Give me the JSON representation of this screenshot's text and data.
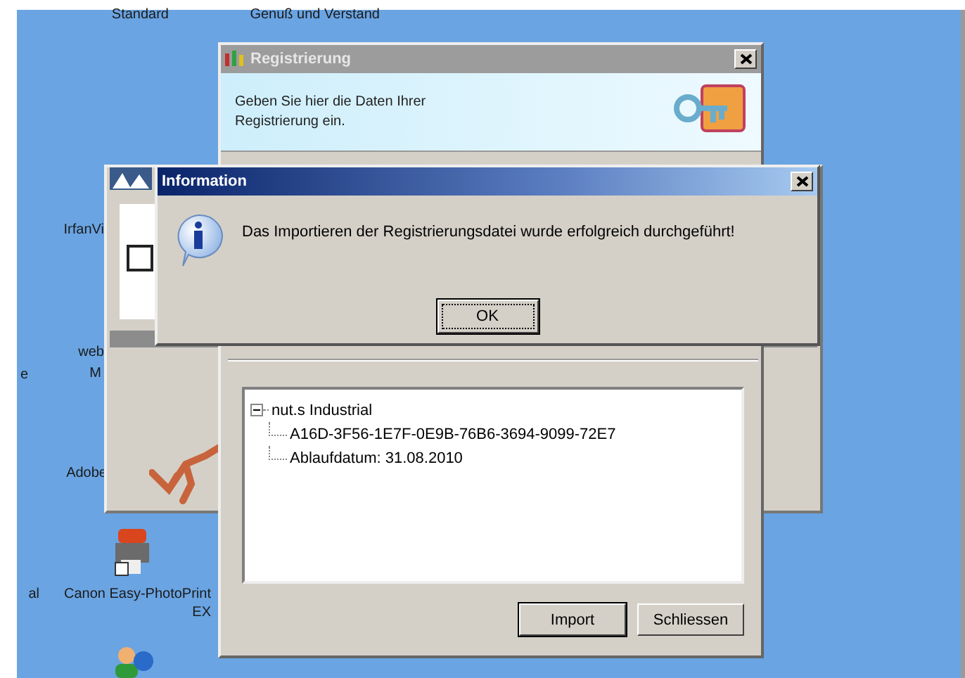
{
  "desktop_labels": [
    {
      "label": "Standard"
    },
    {
      "label": "Genuß und Verstand"
    },
    {
      "label": "IrfanVi"
    },
    {
      "label": "web"
    },
    {
      "label": "M"
    },
    {
      "label": "e"
    },
    {
      "label": "Adobe"
    },
    {
      "label": "al"
    },
    {
      "label": "Canon Easy-PhotoPrint EX"
    }
  ],
  "background_window": {
    "checkbox": {
      "checked": false
    }
  },
  "registration_window": {
    "title": "Registrierung",
    "header_text": "Geben Sie hier die Daten Ihrer Registrierung ein.",
    "tree": [
      {
        "label": "nut.s Industrial",
        "expanded": true,
        "children": [
          {
            "label": "A16D-3F56-1E7F-0E9B-76B6-3694-9099-72E7"
          },
          {
            "label": "Ablaufdatum: 31.08.2010"
          }
        ]
      }
    ],
    "buttons": [
      {
        "label": "Import",
        "default": true
      },
      {
        "label": "Schliessen",
        "default": false
      }
    ]
  },
  "info_dialog": {
    "title": "Information",
    "message": "Das Importieren der Registrierungsdatei wurde erfolgreich durchgeführt!",
    "button": "OK"
  }
}
